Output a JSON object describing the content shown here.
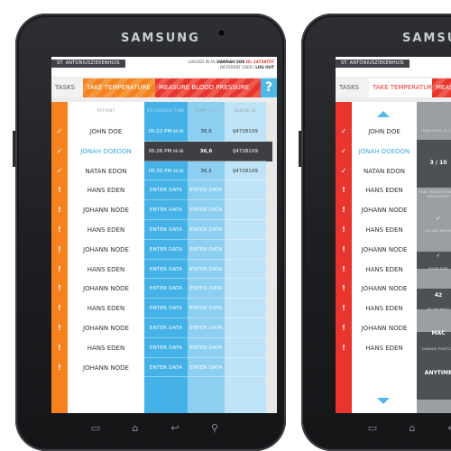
{
  "device": {
    "brand": "SAMSUNG"
  },
  "header": {
    "hospital": "ST. ANTONIUSZIEKENHUIS",
    "logged_in_prefix": "LOGGED IN AS",
    "user": "HANNAH EDE",
    "id_label": "ID: 14728TFF",
    "different_user": "DIFFERENT USER?",
    "logout": "LOG OUT"
  },
  "tabs": {
    "tasks": "TASKS",
    "temperature": "TAKE TEMPERATURE",
    "blood_pressure": "MEASURE BLOOD PRESSURE",
    "help": "?"
  },
  "screen1": {
    "columns": {
      "patient": "PATIENT",
      "time": "RECORDED TIME",
      "temp": "TEMP (°C)",
      "nurse": "NURSE ID"
    },
    "rows": [
      {
        "mark": "✓",
        "name": "JOHN DOE",
        "time": "05:23 PM",
        "date": "06.06",
        "temp": "36,9",
        "nurse": "IJ47281X9",
        "selected": false
      },
      {
        "mark": "✓",
        "name": "JONAH DOEDON",
        "time": "05:26 PM",
        "date": "06.06",
        "temp": "36,6",
        "nurse": "IJ47281X9",
        "selected": true
      },
      {
        "mark": "✓",
        "name": "NATAN EDON",
        "time": "05:30 PM",
        "date": "06.06",
        "temp": "36,3",
        "nurse": "IJ47281X9",
        "selected": false
      },
      {
        "mark": "!",
        "name": "HANS EDEN",
        "time": "ENTER DATA",
        "date": "",
        "temp": "ENTER DATA",
        "nurse": "",
        "selected": false
      },
      {
        "mark": "!",
        "name": "JOHANN NODE",
        "time": "ENTER DATA",
        "date": "",
        "temp": "ENTER DATA",
        "nurse": "",
        "selected": false
      },
      {
        "mark": "!",
        "name": "HANS EDEN",
        "time": "ENTER DATA",
        "date": "",
        "temp": "ENTER DATA",
        "nurse": "",
        "selected": false
      },
      {
        "mark": "!",
        "name": "JOHANN NODE",
        "time": "ENTER DATA",
        "date": "",
        "temp": "ENTER DATA",
        "nurse": "",
        "selected": false
      },
      {
        "mark": "!",
        "name": "HANS EDEN",
        "time": "ENTER DATA",
        "date": "",
        "temp": "ENTER DATA",
        "nurse": "",
        "selected": false
      },
      {
        "mark": "!",
        "name": "JOHANN NODE",
        "time": "ENTER DATA",
        "date": "",
        "temp": "ENTER DATA",
        "nurse": "",
        "selected": false
      },
      {
        "mark": "!",
        "name": "HANS EDEN",
        "time": "ENTER DATA",
        "date": "",
        "temp": "ENTER DATA",
        "nurse": "",
        "selected": false
      },
      {
        "mark": "!",
        "name": "JOHANN NODE",
        "time": "ENTER DATA",
        "date": "",
        "temp": "ENTER DATA",
        "nurse": "",
        "selected": false
      },
      {
        "mark": "!",
        "name": "HANS EDEN",
        "time": "ENTER DATA",
        "date": "",
        "temp": "ENTER DATA",
        "nurse": "",
        "selected": false
      },
      {
        "mark": "!",
        "name": "JOHANN NODE",
        "time": "ENTER DATA",
        "date": "",
        "temp": "ENTER DATA",
        "nurse": "",
        "selected": false
      }
    ]
  },
  "screen2": {
    "rows": [
      {
        "mark": "✓",
        "name": "JOHN DOE",
        "selected": false
      },
      {
        "mark": "✓",
        "name": "JONAH DOEDON",
        "selected": true
      },
      {
        "mark": "✓",
        "name": "NATAN EDON",
        "selected": false
      },
      {
        "mark": "!",
        "name": "HANS EDEN",
        "selected": false
      },
      {
        "mark": "!",
        "name": "JOHANN NODE",
        "selected": false
      },
      {
        "mark": "!",
        "name": "HANS EDEN",
        "selected": false
      },
      {
        "mark": "!",
        "name": "JOHANN NODE",
        "selected": false
      },
      {
        "mark": "!",
        "name": "HANS EDEN",
        "selected": false
      },
      {
        "mark": "!",
        "name": "JOHANN NODE",
        "selected": false
      },
      {
        "mark": "!",
        "name": "HANS EDEN",
        "selected": false
      },
      {
        "mark": "!",
        "name": "JOHANN NODE",
        "selected": false
      },
      {
        "mark": "!",
        "name": "HANS EDEN",
        "selected": false
      }
    ],
    "questions": [
      {
        "label": "PAIN LEVEL (1-10)",
        "value": ""
      },
      {
        "label": "",
        "value": "3 / 10"
      },
      {
        "label": "TAKE NONSTEROIDAL MEDICATION",
        "value": ""
      },
      {
        "label": "",
        "value": "✓"
      },
      {
        "label": "CALLED NURSE",
        "value": ""
      },
      {
        "label": "",
        "value": "✓"
      },
      {
        "label": "FOOD SIZE",
        "value": ""
      },
      {
        "label": "",
        "value": "42"
      },
      {
        "label": "PC OR MAC?",
        "value": ""
      },
      {
        "label": "",
        "value": "MAC"
      },
      {
        "label": "CHANGE POSITION",
        "value": ""
      },
      {
        "label": "",
        "value": "ANYTIME"
      }
    ]
  },
  "colors": {
    "orange": "#f5821f",
    "red": "#e8362e",
    "blue": "#44b2e6",
    "dark": "#3d3f44"
  }
}
